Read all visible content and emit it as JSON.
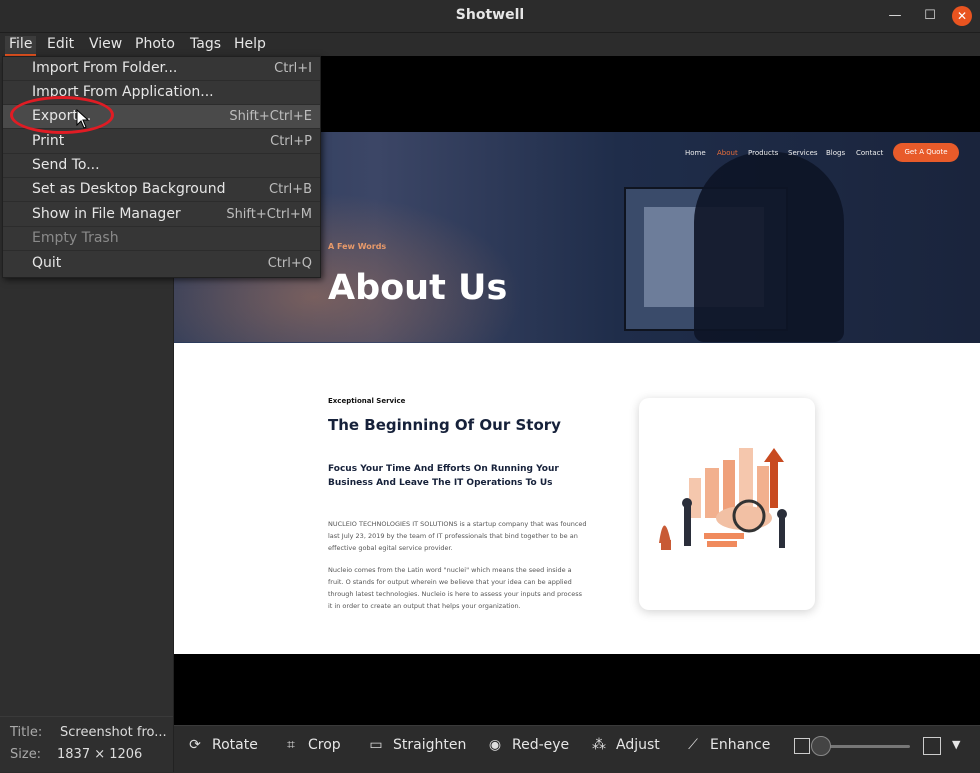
{
  "window": {
    "title": "Shotwell",
    "minimize": "—",
    "maximize": "☐",
    "close": "✕"
  },
  "menubar": [
    "File",
    "Edit",
    "View",
    "Photo",
    "Tags",
    "Help"
  ],
  "file_menu": [
    {
      "label": "Import From Folder...",
      "accel": "Ctrl+I"
    },
    {
      "label": "Import From Application...",
      "accel": ""
    },
    {
      "label": "Export...",
      "accel": "Shift+Ctrl+E"
    },
    {
      "label": "Print",
      "accel": "Ctrl+P"
    },
    {
      "label": "Send To...",
      "accel": ""
    },
    {
      "label": "Set as Desktop Background",
      "accel": "Ctrl+B"
    },
    {
      "label": "Show in File Manager",
      "accel": "Shift+Ctrl+M"
    },
    {
      "label": "Empty Trash",
      "accel": ""
    },
    {
      "label": "Quit",
      "accel": "Ctrl+Q"
    }
  ],
  "info": {
    "title_label": "Title:",
    "title_value": "Screenshot fro...",
    "size_label": "Size:",
    "size_value": "1837 × 1206"
  },
  "photo": {
    "nav": [
      "Home",
      "About",
      "Products",
      "Services",
      "Blogs",
      "Contact"
    ],
    "cta": "Get A Quote",
    "kicker": "A Few Words",
    "heading": "About Us",
    "section_kicker": "Exceptional Service",
    "section_title": "The Beginning Of Our Story",
    "section_subtitle": "Focus Your Time And Efforts On Running Your Business And Leave The IT Operations To Us",
    "para1": "NUCLEIO TECHNOLOGIES IT SOLUTIONS is a startup company that was founced last July 23, 2019 by the team of IT professionals that bind together to be an effective gobal egital service provider.",
    "para2": "Nucleio comes from the Latin word \"nuclei\" which means the seed inside a fruit. O stands for output wherein we believe that your idea can be applied through latest technologies. Nucleio is here to assess your inputs and process it in order to create an output that helps your organization."
  },
  "toolbar": {
    "rotate": "Rotate",
    "crop": "Crop",
    "straighten": "Straighten",
    "redeye": "Red-eye",
    "adjust": "Adjust",
    "enhance": "Enhance"
  }
}
